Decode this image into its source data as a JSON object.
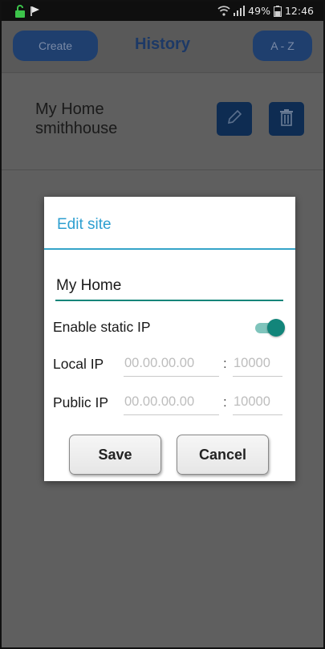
{
  "status_bar": {
    "battery": "49%",
    "time": "12:46",
    "icons": [
      "unlock-icon",
      "flag-icon",
      "wifi-icon",
      "signal-icon",
      "battery-icon"
    ]
  },
  "header": {
    "create_label": "Create",
    "title": "History",
    "sort_label": "A - Z"
  },
  "history": {
    "items": [
      {
        "name": "My Home",
        "host": "smithhouse"
      }
    ]
  },
  "dialog": {
    "title": "Edit site",
    "name_value": "My Home",
    "static_ip_label": "Enable static IP",
    "static_ip_enabled": true,
    "local_ip_label": "Local IP",
    "local_ip_placeholder": "00.00.00.00",
    "local_port_placeholder": "10000",
    "public_ip_label": "Public IP",
    "public_ip_placeholder": "00.00.00.00",
    "public_port_placeholder": "10000",
    "colon": ":",
    "save_label": "Save",
    "cancel_label": "Cancel"
  },
  "colors": {
    "header_button": "#1f3f6e",
    "icon_button": "#0e2c52",
    "dialog_title": "#2d9fd0",
    "accent_teal": "#12857a"
  }
}
